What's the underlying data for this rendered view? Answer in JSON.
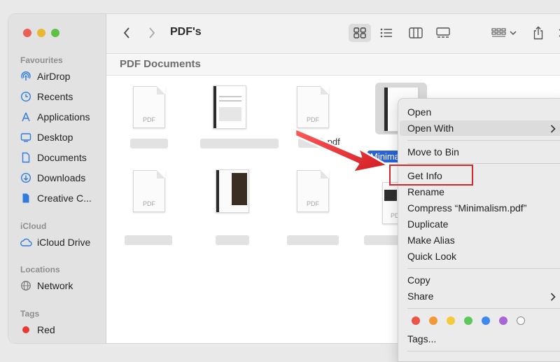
{
  "window": {
    "title": "PDF's",
    "folder_label": "PDF Documents"
  },
  "sidebar": {
    "sections": {
      "favourites": "Favourites",
      "icloud": "iCloud",
      "locations": "Locations",
      "tags": "Tags"
    },
    "favourites": [
      {
        "label": "AirDrop",
        "icon": "airdrop-icon"
      },
      {
        "label": "Recents",
        "icon": "clock-icon"
      },
      {
        "label": "Applications",
        "icon": "applications-icon"
      },
      {
        "label": "Desktop",
        "icon": "desktop-icon"
      },
      {
        "label": "Documents",
        "icon": "document-icon"
      },
      {
        "label": "Downloads",
        "icon": "download-icon"
      },
      {
        "label": "Creative C...",
        "icon": "file-icon"
      }
    ],
    "icloud": [
      {
        "label": "iCloud Drive",
        "icon": "cloud-icon"
      }
    ],
    "locations": [
      {
        "label": "Network",
        "icon": "globe-icon"
      }
    ],
    "tags": [
      {
        "label": "Red",
        "color": "#ea3a30"
      }
    ]
  },
  "files": [
    {
      "name": "",
      "ext": "PDF"
    },
    {
      "name": "",
      "ext": ""
    },
    {
      "name": ".pdf",
      "ext": "PDF"
    },
    {
      "name": "Minimalis",
      "ext": "",
      "selected": true
    },
    {
      "name": "",
      "ext": "PDF"
    },
    {
      "name": "",
      "ext": ""
    },
    {
      "name": "",
      "ext": "PDF"
    },
    {
      "name": "",
      "ext": "PDF"
    }
  ],
  "context_menu": {
    "items": {
      "open": "Open",
      "open_with": "Open With",
      "move_to_bin": "Move to Bin",
      "get_info": "Get Info",
      "rename": "Rename",
      "compress": "Compress “Minimalism.pdf”",
      "duplicate": "Duplicate",
      "make_alias": "Make Alias",
      "quick_look": "Quick Look",
      "copy": "Copy",
      "share": "Share",
      "tags": "Tags..."
    },
    "tag_colors": [
      "#ea5545",
      "#f29a38",
      "#f4ca3c",
      "#5cc85a",
      "#3f88ee",
      "#a865d8",
      "#ffffff"
    ]
  },
  "colors": {
    "selection": "#2962d9",
    "highlight_border": "#d5272c",
    "arrow": "#e8262b"
  }
}
